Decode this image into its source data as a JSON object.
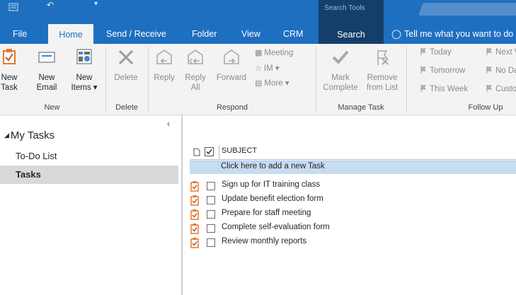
{
  "window": {
    "contextual_tab_group": "Search Tools"
  },
  "tabs": [
    {
      "label": "File"
    },
    {
      "label": "Home"
    },
    {
      "label": "Send / Receive"
    },
    {
      "label": "Folder"
    },
    {
      "label": "View"
    },
    {
      "label": "CRM"
    },
    {
      "label": "Search"
    }
  ],
  "tell_me": "Tell me what you want to do",
  "ribbon": {
    "new_group": {
      "label": "New",
      "new_task_line1": "New",
      "new_task_line2": "Task",
      "new_email_line1": "New",
      "new_email_line2": "Email",
      "new_items_line1": "New",
      "new_items_line2": "Items ▾"
    },
    "delete_group": {
      "label": "Delete",
      "delete": "Delete"
    },
    "respond_group": {
      "label": "Respond",
      "reply": "Reply",
      "reply_all_line1": "Reply",
      "reply_all_line2": "All",
      "forward": "Forward",
      "meeting": "Meeting",
      "im": "IM ▾",
      "more": "More ▾"
    },
    "manage_group": {
      "label": "Manage Task",
      "mark_line1": "Mark",
      "mark_line2": "Complete",
      "remove_line1": "Remove",
      "remove_line2": "from List"
    },
    "followup_group": {
      "label": "Follow Up",
      "today": "Today",
      "tomorrow": "Tomorrow",
      "this_week": "This Week",
      "next": "Next Week",
      "no_date": "No Date",
      "custom": "Custom"
    }
  },
  "nav": {
    "header": "My Tasks",
    "items": [
      {
        "label": "To-Do List",
        "selected": false
      },
      {
        "label": "Tasks",
        "selected": true
      }
    ]
  },
  "tasklist": {
    "column_subject": "SUBJECT",
    "add_placeholder": "Click here to add a new Task",
    "tasks": [
      {
        "subject": "Sign up for IT training class"
      },
      {
        "subject": "Update benefit election form"
      },
      {
        "subject": "Prepare for staff meeting"
      },
      {
        "subject": "Complete self-evaluation form"
      },
      {
        "subject": "Review monthly reports"
      }
    ]
  },
  "colors": {
    "title_bar": "#1e6fc0",
    "dark_tab": "#143f6b",
    "ribbon_bg": "#f3f3f3",
    "selection": "#d9d9d9",
    "add_row": "#c7dcf1",
    "task_icon": "#e07b2a"
  },
  "icons": [
    "new-task-icon",
    "new-email-icon",
    "new-items-icon",
    "delete-icon",
    "reply-icon",
    "reply-all-icon",
    "forward-icon",
    "meeting-icon",
    "im-icon",
    "more-icon",
    "mark-complete-icon",
    "remove-from-list-icon",
    "flag-icon",
    "task-item-icon",
    "checkbox-icon",
    "document-icon",
    "collapse-chevron-icon"
  ]
}
